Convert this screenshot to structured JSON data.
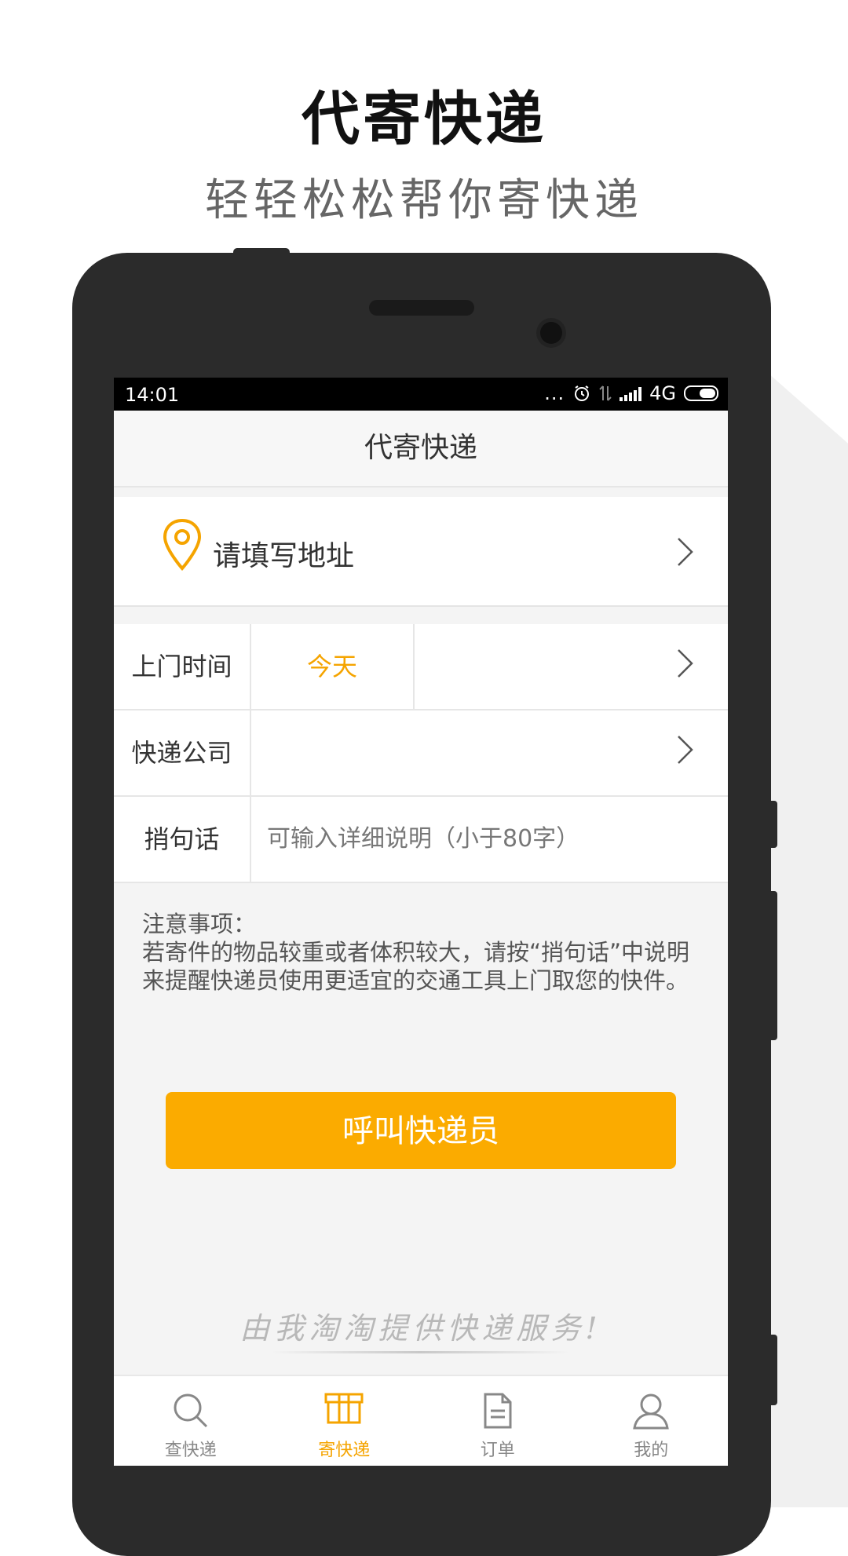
{
  "promo": {
    "title": "代寄快递",
    "subtitle": "轻轻松松帮你寄快递"
  },
  "statusbar": {
    "time": "14:01",
    "dots": "...",
    "network": "4G"
  },
  "header": {
    "title": "代寄快递"
  },
  "address": {
    "placeholder": "请填写地址"
  },
  "form": {
    "pickup_time_label": "上门时间",
    "pickup_time_value": "今天",
    "courier_label": "快递公司",
    "message_label": "捎句话",
    "message_placeholder": "可输入详细说明（小于80字）"
  },
  "notice": {
    "heading": "注意事项：",
    "body": "若寄件的物品较重或者体积较大，请按“捎句话”中说明来提醒快递员使用更适宜的交通工具上门取您的快件。"
  },
  "call_button": {
    "label": "呼叫快递员"
  },
  "slogan": "由我淘淘提供快递服务!",
  "tabs": [
    {
      "label": "查快递",
      "icon": "search-icon"
    },
    {
      "label": "寄快递",
      "icon": "box-icon"
    },
    {
      "label": "订单",
      "icon": "document-icon"
    },
    {
      "label": "我的",
      "icon": "user-icon"
    }
  ],
  "colors": {
    "accent": "#fbab00",
    "accent_text": "#f5a400",
    "phone_body": "#2b2b2b"
  }
}
